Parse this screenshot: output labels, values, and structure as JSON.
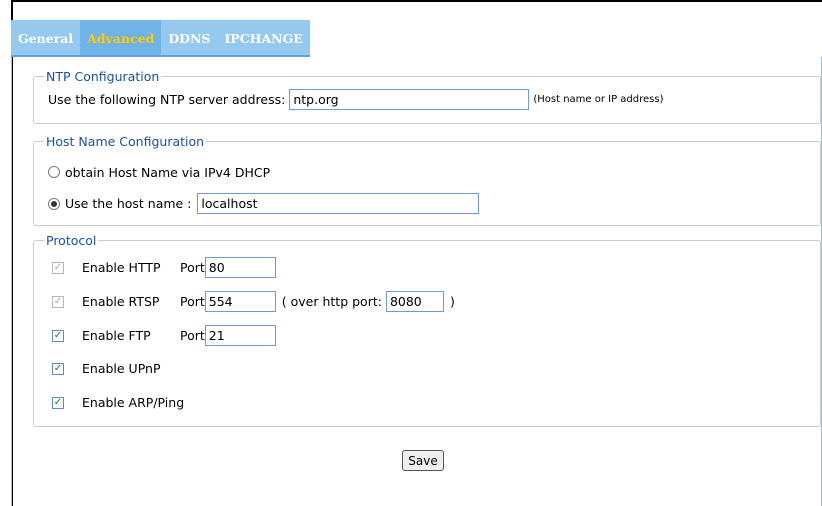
{
  "tabs": [
    {
      "label": "General",
      "active": false
    },
    {
      "label": "Advanced",
      "active": true
    },
    {
      "label": "DDNS",
      "active": false
    },
    {
      "label": "IPCHANGE",
      "active": false
    }
  ],
  "ntp": {
    "legend": "NTP Configuration",
    "label": "Use the following NTP server address:",
    "value": "ntp.org",
    "hint": "(Host name or IP address)"
  },
  "hostname": {
    "legend": "Host Name Configuration",
    "option_dhcp": {
      "label": "obtain Host Name via IPv4 DHCP",
      "selected": false
    },
    "option_manual": {
      "label": "Use the host name :",
      "selected": true
    },
    "value": "localhost"
  },
  "protocol": {
    "legend": "Protocol",
    "http": {
      "label": "Enable HTTP",
      "port_label": "Port",
      "port": "80",
      "checked": true,
      "disabled": true
    },
    "rtsp": {
      "label": "Enable RTSP",
      "port_label": "Port",
      "port": "554",
      "checked": true,
      "disabled": true,
      "over_label": "( over http port:",
      "over_port": "8080",
      "close": ")"
    },
    "ftp": {
      "label": "Enable FTP",
      "port_label": "Port",
      "port": "21",
      "checked": true,
      "disabled": false
    },
    "upnp": {
      "label": "Enable UPnP",
      "checked": true
    },
    "arp": {
      "label": "Enable ARP/Ping",
      "checked": true
    }
  },
  "save_label": "Save",
  "colors": {
    "tab_bar": "#b8dcf6",
    "active_tab_text": "#ffcc00",
    "legend": "#1c4f9e"
  }
}
